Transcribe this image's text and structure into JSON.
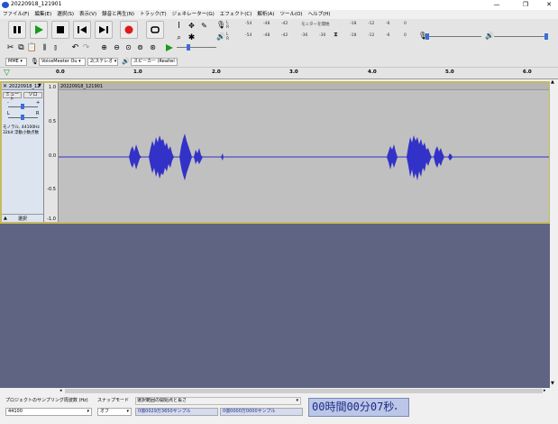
{
  "window": {
    "title": "20220918_121901"
  },
  "menu": [
    "ファイル(F)",
    "編集(E)",
    "選択(S)",
    "表示(V)",
    "録音と再生(N)",
    "トラック(T)",
    "ジェネレーター(G)",
    "エフェクト(C)",
    "解析(A)",
    "ツール(O)",
    "ヘルプ(H)"
  ],
  "meter": {
    "rec_ticks": [
      "-54",
      "-48",
      "-42",
      "モニターを開始",
      "-18",
      "-12",
      "-6",
      "0"
    ],
    "play_ticks": [
      "-54",
      "-48",
      "-42",
      "-36",
      "-30",
      "-24",
      "-18",
      "-12",
      "-6",
      "0"
    ],
    "rec_start": "-36",
    "rec_mid": "-30",
    "rec_mid2": "-24",
    "lr_l": "L",
    "lr_r": "R"
  },
  "device": {
    "host": "MME",
    "input": "VoiceMeeter Ou",
    "channels": "2(ステレオ",
    "output": "スピーカー (Realtel"
  },
  "ruler": {
    "ticks": [
      "0.0",
      "1.0",
      "2.0",
      "3.0",
      "4.0",
      "5.0",
      "6.0"
    ]
  },
  "track": {
    "name": "20220918_12",
    "clip": "20220918_121901",
    "mute": "ミュート",
    "solo": "ソロ",
    "gain_minus": "-",
    "gain_plus": "+",
    "pan_l": "L",
    "pan_r": "R",
    "info1": "モノラル, 44100Hz",
    "info2": "32bit 浮動小数点数",
    "select": "選択"
  },
  "vscale": [
    "1.0",
    "0.5",
    "0.0",
    "-0.5",
    "-1.0"
  ],
  "bottom": {
    "rate_label": "プロジェクトのサンプリング周波数 (Hz)",
    "snap_label": "スナップモード",
    "sel_label": "選択範囲の開始点と長さ",
    "rate": "44100",
    "snap": "オフ",
    "sel_start": "0億0029万3650サンプル",
    "sel_len": "0億0000万0000サンプル",
    "time": "00時間00分07秒"
  },
  "colors": {
    "wave": "#3232c8",
    "track_bg": "#c0c0c0",
    "empty": "#5f6482",
    "time": "#1d2b8a"
  }
}
